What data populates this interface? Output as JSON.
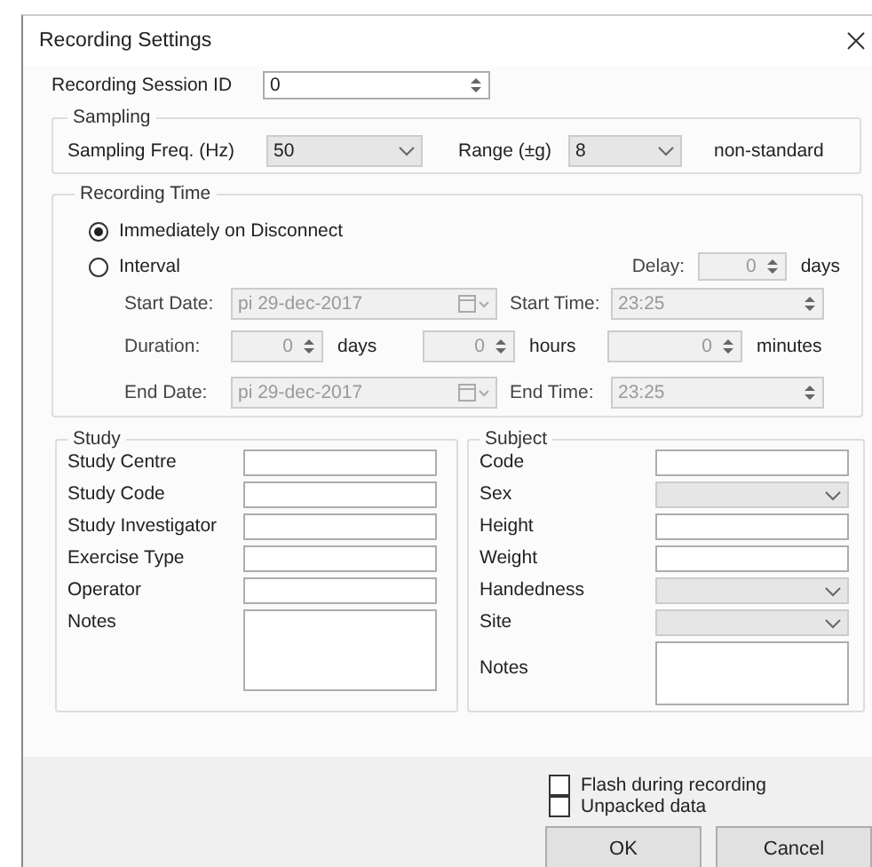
{
  "window": {
    "title": "Recording Settings"
  },
  "session": {
    "label": "Recording Session ID",
    "value": "0"
  },
  "sampling": {
    "title": "Sampling",
    "fields": [
      {
        "label": "Sampling Freq. (Hz)",
        "value": "50"
      },
      {
        "label": "Range (±g)",
        "value": "8"
      }
    ],
    "note": "non-standard"
  },
  "recording_time": {
    "title": "Recording Time",
    "options": [
      {
        "label": "Immediately on Disconnect",
        "selected": true
      },
      {
        "label": "Interval",
        "selected": false
      }
    ],
    "interval_disabled": true,
    "delay": {
      "label": "Delay:",
      "value": "0",
      "unit": "days"
    },
    "start_date": {
      "label": "Start Date:",
      "value": "pi 29-dec-2017"
    },
    "start_time": {
      "label": "Start Time:",
      "value": "23:25"
    },
    "duration": {
      "label": "Duration:",
      "parts": [
        {
          "value": "0",
          "unit": "days"
        },
        {
          "value": "0",
          "unit": "hours"
        },
        {
          "value": "0",
          "unit": "minutes"
        }
      ]
    },
    "end_date": {
      "label": "End Date:",
      "value": "pi 29-dec-2017"
    },
    "end_time": {
      "label": "End Time:",
      "value": "23:25"
    }
  },
  "study": {
    "title": "Study",
    "fields": [
      {
        "label": "Study Centre",
        "kind": "text"
      },
      {
        "label": "Study Code",
        "kind": "text"
      },
      {
        "label": "Study Investigator",
        "kind": "text"
      },
      {
        "label": "Exercise Type",
        "kind": "text"
      },
      {
        "label": "Operator",
        "kind": "text"
      },
      {
        "label": "Notes",
        "kind": "multiline"
      }
    ]
  },
  "subject": {
    "title": "Subject",
    "fields": [
      {
        "label": "Code",
        "kind": "text"
      },
      {
        "label": "Sex",
        "kind": "select"
      },
      {
        "label": "Height",
        "kind": "text"
      },
      {
        "label": "Weight",
        "kind": "text"
      },
      {
        "label": "Handedness",
        "kind": "select"
      },
      {
        "label": "Site",
        "kind": "select"
      },
      {
        "label": "Notes",
        "kind": "multiline"
      }
    ]
  },
  "options": [
    {
      "label": "Flash during recording",
      "checked": false
    },
    {
      "label": "Unpacked data",
      "checked": false
    }
  ],
  "buttons": [
    "OK",
    "Cancel"
  ]
}
